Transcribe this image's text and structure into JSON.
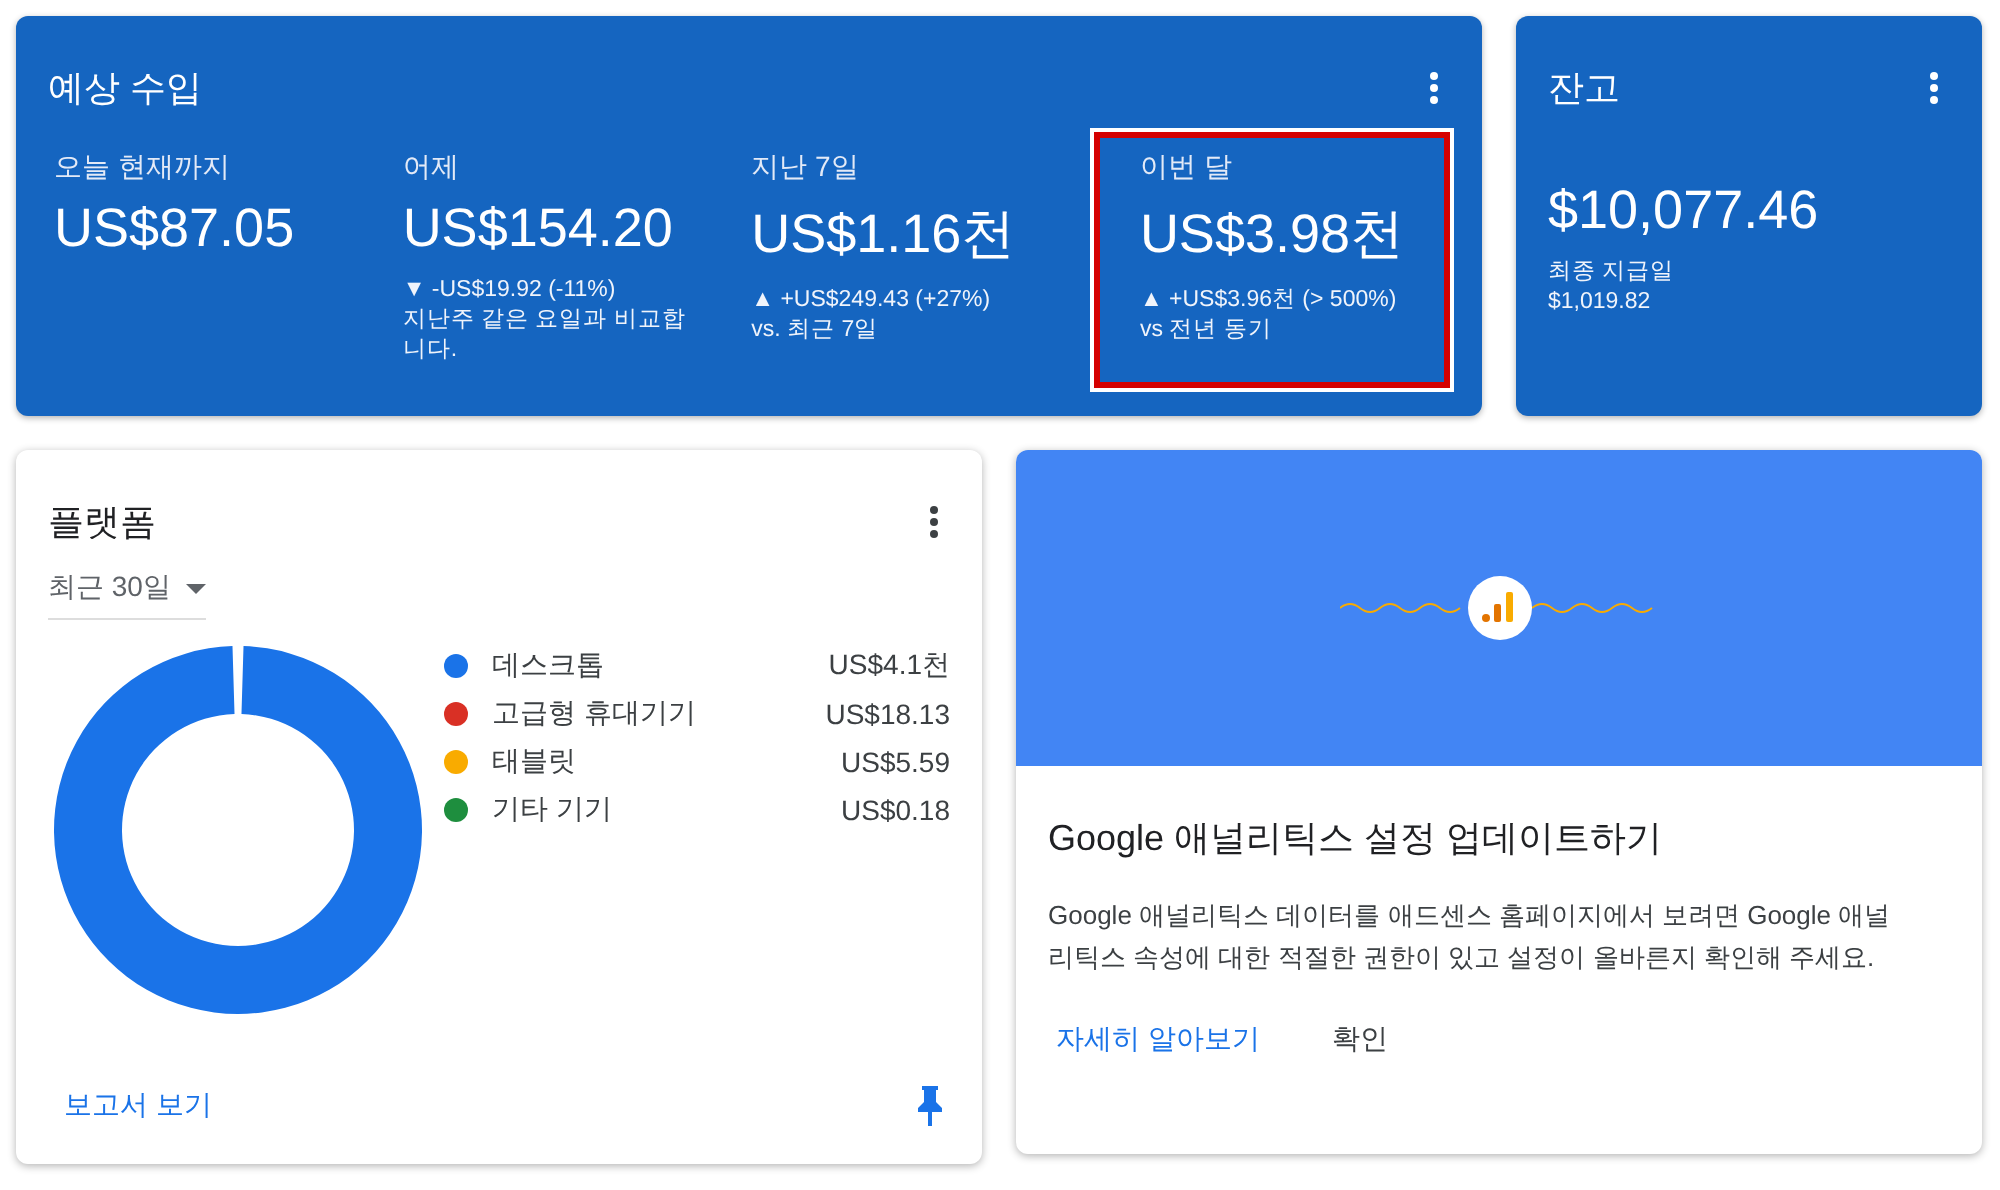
{
  "earnings": {
    "title": "예상 수입",
    "metrics": [
      {
        "label": "오늘 현재까지",
        "value": "US$87.05",
        "highlighted": false
      },
      {
        "label": "어제",
        "value": "US$154.20",
        "change": "▼ -US$19.92 (-11%)",
        "note": "지난주 같은 요일과 비교합니다.",
        "highlighted": false
      },
      {
        "label": "지난 7일",
        "value": "US$1.16천",
        "change": "▲ +US$249.43 (+27%)",
        "note": "vs. 최근 7일",
        "highlighted": false
      },
      {
        "label": "이번 달",
        "value": "US$3.98천",
        "change": "▲ +US$3.96천 (> 500%)",
        "note": "vs 전년 동기",
        "highlighted": true
      }
    ]
  },
  "balance": {
    "title": "잔고",
    "value": "$10,077.46",
    "note": "최종 지급일",
    "last_payment": "$1,019.82"
  },
  "platforms": {
    "title": "플랫폼",
    "range": "최근 30일",
    "legend": [
      {
        "label": "데스크톱",
        "amount": "US$4.1천",
        "color": "#1a73e8"
      },
      {
        "label": "고급형 휴대기기",
        "amount": "US$18.13",
        "color": "#d93025"
      },
      {
        "label": "태블릿",
        "amount": "US$5.59",
        "color": "#f9ab00"
      },
      {
        "label": "기타 기기",
        "amount": "US$0.18",
        "color": "#1e8e3e"
      }
    ],
    "link": "보고서 보기"
  },
  "analytics": {
    "title": "Google 애널리틱스 설정 업데이트하기",
    "body": "Google 애널리틱스 데이터를 애드센스 홈페이지에서 보려면 Google 애널리틱스 속성에 대한 적절한 권한이 있고 설정이 올바른지 확인해 주세요.",
    "actions": [
      {
        "label": "자세히 알아보기",
        "kind": "link"
      },
      {
        "label": "확인",
        "kind": "plain"
      }
    ]
  }
}
